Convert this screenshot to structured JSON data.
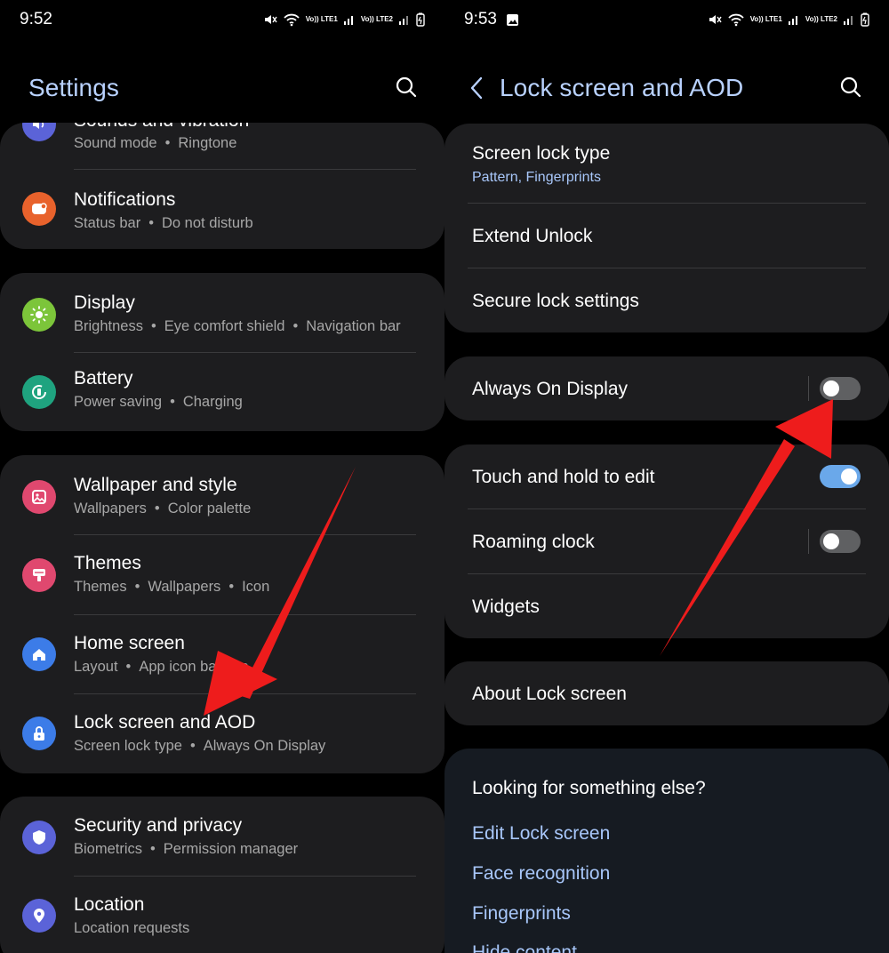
{
  "left": {
    "status": {
      "time": "9:52",
      "net1": "Vo)) LTE1",
      "net2": "Vo)) LTE2"
    },
    "header": {
      "title": "Settings"
    },
    "groups": [
      {
        "items": [
          {
            "title": "Sounds and vibration",
            "subs": [
              "Sound mode",
              "Ringtone"
            ],
            "icon": "sound-icon",
            "color": "#5b63d8"
          },
          {
            "title": "Notifications",
            "subs": [
              "Status bar",
              "Do not disturb"
            ],
            "icon": "notification-icon",
            "color": "#e8622c"
          }
        ]
      },
      {
        "items": [
          {
            "title": "Display",
            "subs": [
              "Brightness",
              "Eye comfort shield",
              "Navigation bar"
            ],
            "icon": "display-icon",
            "color": "#7cc53a"
          },
          {
            "title": "Battery",
            "subs": [
              "Power saving",
              "Charging"
            ],
            "icon": "battery-icon",
            "color": "#1fa37f"
          }
        ]
      },
      {
        "items": [
          {
            "title": "Wallpaper and style",
            "subs": [
              "Wallpapers",
              "Color palette"
            ],
            "icon": "wallpaper-icon",
            "color": "#e0486f"
          },
          {
            "title": "Themes",
            "subs": [
              "Themes",
              "Wallpapers",
              "Icon"
            ],
            "icon": "themes-icon",
            "color": "#e0486f"
          },
          {
            "title": "Home screen",
            "subs": [
              "Layout",
              "App icon badges"
            ],
            "icon": "home-icon",
            "color": "#3c7ce8"
          },
          {
            "title": "Lock screen and AOD",
            "subs": [
              "Screen lock type",
              "Always On Display"
            ],
            "icon": "lock-icon",
            "color": "#3c7ce8"
          }
        ]
      },
      {
        "items": [
          {
            "title": "Security and privacy",
            "subs": [
              "Biometrics",
              "Permission manager"
            ],
            "icon": "shield-icon",
            "color": "#5b63d8"
          },
          {
            "title": "Location",
            "subs": [
              "Location requests"
            ],
            "icon": "location-icon",
            "color": "#5b63d8"
          }
        ]
      }
    ]
  },
  "right": {
    "status": {
      "time": "9:53",
      "net1": "Vo)) LTE1",
      "net2": "Vo)) LTE2"
    },
    "header": {
      "title": "Lock screen and AOD"
    },
    "card1": {
      "screen_lock_type": "Screen lock type",
      "screen_lock_value": "Pattern, Fingerprints",
      "extend_unlock": "Extend Unlock",
      "secure_lock": "Secure lock settings"
    },
    "card2": {
      "aod_label": "Always On Display",
      "aod_on": false
    },
    "card3": {
      "touch_hold": "Touch and hold to edit",
      "touch_hold_on": true,
      "roaming_clock": "Roaming clock",
      "roaming_clock_on": false,
      "widgets": "Widgets"
    },
    "card4": {
      "about": "About Lock screen"
    },
    "looking": {
      "title": "Looking for something else?",
      "links": [
        "Edit Lock screen",
        "Face recognition",
        "Fingerprints",
        "Hide content"
      ]
    }
  },
  "colors": {
    "accent": "#a8c7fa",
    "card_bg": "#1d1d1f",
    "arrow": "#ee1c1c"
  }
}
